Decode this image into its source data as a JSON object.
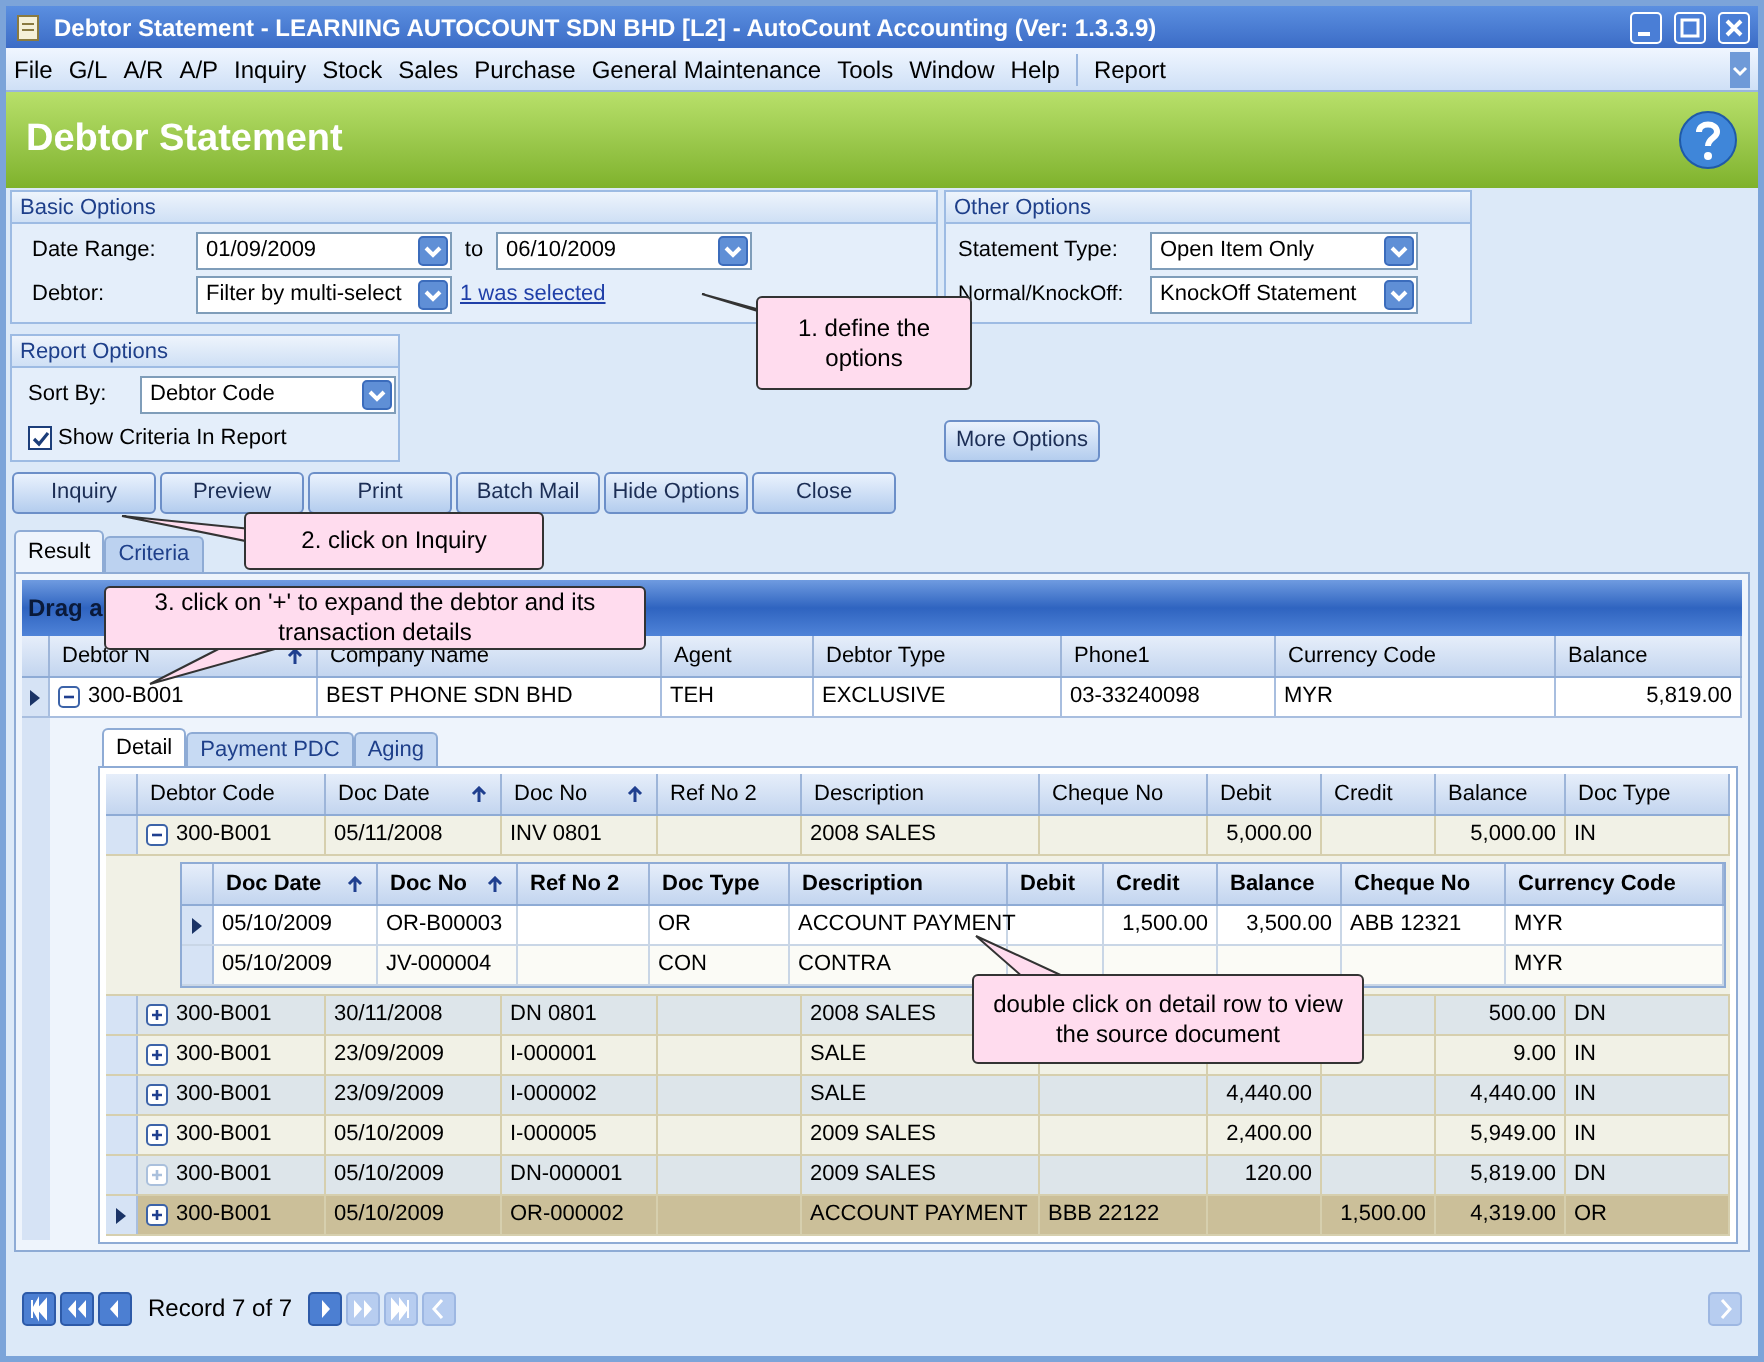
{
  "window": {
    "title": "Debtor Statement - LEARNING AUTOCOUNT SDN BHD [L2] - AutoCount Accounting (Ver: 1.3.3.9)"
  },
  "menu": [
    "File",
    "G/L",
    "A/R",
    "A/P",
    "Inquiry",
    "Stock",
    "Sales",
    "Purchase",
    "General Maintenance",
    "Tools",
    "Window",
    "Help",
    "Report"
  ],
  "header": {
    "title": "Debtor Statement"
  },
  "basic_options": {
    "title": "Basic Options",
    "date_range_label": "Date Range:",
    "date_from": "01/09/2009",
    "to_label": "to",
    "date_to": "06/10/2009",
    "debtor_label": "Debtor:",
    "debtor_filter": "Filter by multi-select",
    "selection_link": "1 was selected"
  },
  "other_options": {
    "title": "Other Options",
    "statement_type_label": "Statement Type:",
    "statement_type": "Open Item Only",
    "knockoff_label": "Normal/KnockOff:",
    "knockoff": "KnockOff Statement"
  },
  "report_options": {
    "title": "Report Options",
    "sort_by_label": "Sort By:",
    "sort_by": "Debtor Code",
    "show_criteria": {
      "label": "Show Criteria In Report",
      "checked": true
    }
  },
  "more_options_button": "More Options",
  "buttons": [
    "Inquiry",
    "Preview",
    "Print",
    "Batch Mail",
    "Hide Options",
    "Close"
  ],
  "result_tabs": [
    {
      "label": "Result",
      "selected": true
    },
    {
      "label": "Criteria",
      "selected": false
    }
  ],
  "group_panel": "Drag a",
  "master": {
    "columns": [
      {
        "label": "Debtor N",
        "sorted": true
      },
      {
        "label": "Company Name",
        "sorted": false
      },
      {
        "label": "Agent",
        "sorted": false
      },
      {
        "label": "Debtor Type",
        "sorted": false
      },
      {
        "label": "Phone1",
        "sorted": false
      },
      {
        "label": "Currency Code",
        "sorted": false
      },
      {
        "label": "Balance",
        "sorted": false
      }
    ],
    "rows": [
      {
        "expanded": true,
        "selected": true,
        "cells": [
          "300-B001",
          "BEST PHONE SDN BHD",
          "TEH",
          "EXCLUSIVE",
          "03-33240098",
          "MYR",
          "5,819.00"
        ]
      }
    ]
  },
  "detail_tabs": [
    {
      "label": "Detail",
      "selected": true
    },
    {
      "label": "Payment PDC",
      "selected": false
    },
    {
      "label": "Aging",
      "selected": false
    }
  ],
  "detail": {
    "columns": [
      {
        "label": "Debtor Code",
        "sorted": false
      },
      {
        "label": "Doc Date",
        "sorted": true
      },
      {
        "label": "Doc No",
        "sorted": true
      },
      {
        "label": "Ref No 2",
        "sorted": false
      },
      {
        "label": "Description",
        "sorted": false
      },
      {
        "label": "Cheque No",
        "sorted": false
      },
      {
        "label": "Debit",
        "sorted": false
      },
      {
        "label": "Credit",
        "sorted": false
      },
      {
        "label": "Balance",
        "sorted": false
      },
      {
        "label": "Doc Type",
        "sorted": false
      }
    ],
    "rows": [
      {
        "expanded": true,
        "selected": false,
        "disabled": false,
        "cells": [
          "300-B001",
          "05/11/2008",
          "INV 0801",
          null,
          "2008 SALES",
          null,
          "5,000.00",
          null,
          "5,000.00",
          "IN"
        ],
        "children": {
          "columns": [
            {
              "label": "Doc Date",
              "sorted": true
            },
            {
              "label": "Doc No",
              "sorted": true
            },
            {
              "label": "Ref No 2",
              "sorted": false
            },
            {
              "label": "Doc Type",
              "sorted": false
            },
            {
              "label": "Description",
              "sorted": false
            },
            {
              "label": "Debit",
              "sorted": false
            },
            {
              "label": "Credit",
              "sorted": false
            },
            {
              "label": "Balance",
              "sorted": false
            },
            {
              "label": "Cheque No",
              "sorted": false
            },
            {
              "label": "Currency Code",
              "sorted": false
            }
          ],
          "rows": [
            {
              "selected": true,
              "cells": [
                "05/10/2009",
                "OR-B00003",
                null,
                "OR",
                "ACCOUNT PAYMENT",
                null,
                "1,500.00",
                "3,500.00",
                "ABB 12321",
                "MYR"
              ]
            },
            {
              "selected": false,
              "cells": [
                "05/10/2009",
                "JV-000004",
                null,
                "CON",
                "CONTRA",
                null,
                null,
                null,
                null,
                "MYR"
              ]
            }
          ]
        }
      },
      {
        "expanded": false,
        "selected": false,
        "disabled": false,
        "cells": [
          "300-B001",
          "30/11/2008",
          "DN 0801",
          null,
          "2008 SALES",
          null,
          null,
          null,
          "500.00",
          "DN"
        ]
      },
      {
        "expanded": false,
        "selected": false,
        "disabled": false,
        "cells": [
          "300-B001",
          "23/09/2009",
          "I-000001",
          null,
          "SALE",
          null,
          null,
          null,
          "9.00",
          "IN"
        ]
      },
      {
        "expanded": false,
        "selected": false,
        "disabled": false,
        "cells": [
          "300-B001",
          "23/09/2009",
          "I-000002",
          null,
          "SALE",
          null,
          "4,440.00",
          null,
          "4,440.00",
          "IN"
        ]
      },
      {
        "expanded": false,
        "selected": false,
        "disabled": false,
        "cells": [
          "300-B001",
          "05/10/2009",
          "I-000005",
          null,
          "2009 SALES",
          null,
          "2,400.00",
          null,
          "5,949.00",
          "IN"
        ]
      },
      {
        "expanded": false,
        "selected": false,
        "disabled": true,
        "cells": [
          "300-B001",
          "05/10/2009",
          "DN-000001",
          null,
          "2009 SALES",
          null,
          "120.00",
          null,
          "5,819.00",
          "DN"
        ]
      },
      {
        "expanded": false,
        "selected": true,
        "disabled": false,
        "cells": [
          "300-B001",
          "05/10/2009",
          "OR-000002",
          null,
          "ACCOUNT PAYMENT",
          "BBB 22122",
          null,
          "1,500.00",
          "4,319.00",
          "OR"
        ]
      }
    ]
  },
  "navigator": {
    "record": "Record 7 of 7"
  },
  "callouts": [
    {
      "text": "1. define the options"
    },
    {
      "text": "2. click on Inquiry"
    },
    {
      "text": "3. click on '+' to expand the debtor and its transaction details"
    },
    {
      "text": "double click on detail row to view the source document"
    }
  ]
}
